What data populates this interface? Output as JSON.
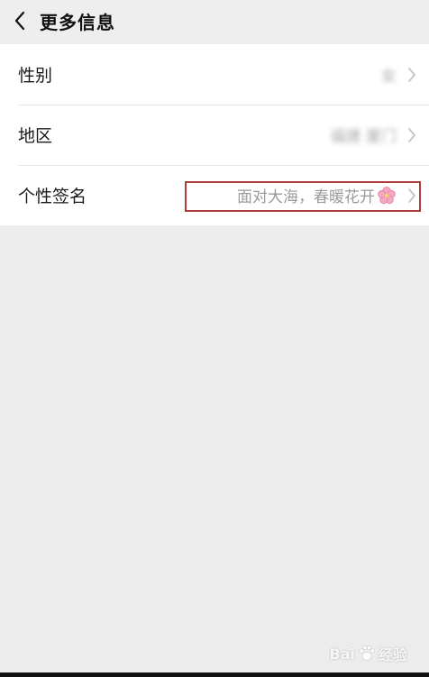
{
  "header": {
    "title": "更多信息",
    "back_icon": "chevron-left-icon"
  },
  "rows": [
    {
      "label": "性别",
      "value": "女"
    },
    {
      "label": "地区",
      "value": "福建 厦门"
    },
    {
      "label": "个性签名",
      "value": "面对大海，春暖花开"
    }
  ],
  "signature": {
    "emoji": "cherry-blossom-icon",
    "highlight_color": "#b03a3a"
  },
  "watermark": {
    "text_left": "Bai",
    "text_right": "经验"
  }
}
